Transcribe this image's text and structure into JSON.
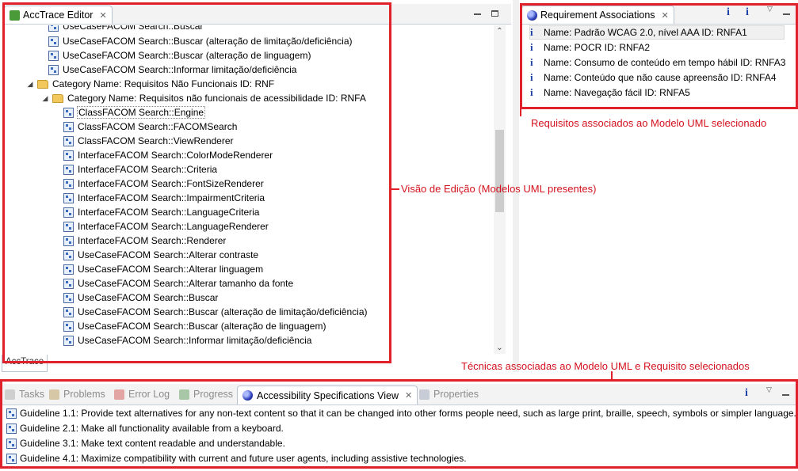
{
  "editor": {
    "title": "AccTrace Editor",
    "rows": [
      {
        "kind": "item",
        "indent": 3,
        "text": "UseCaseFACOM Search::Buscar",
        "partial": true
      },
      {
        "kind": "item",
        "indent": 3,
        "text": "UseCaseFACOM Search::Buscar (alteração de limitação/deficiência)"
      },
      {
        "kind": "item",
        "indent": 3,
        "text": "UseCaseFACOM Search::Buscar (alteração de linguagem)"
      },
      {
        "kind": "item",
        "indent": 3,
        "text": "UseCaseFACOM Search::Informar limitação/deficiência"
      },
      {
        "kind": "folder",
        "indent": 1,
        "text": "Category Name: Requisitos Não Funcionais ID: RNF"
      },
      {
        "kind": "folder",
        "indent": 2,
        "text": "Category Name: Requisitos não funcionais de acessibilidade ID: RNFA"
      },
      {
        "kind": "item",
        "indent": 4,
        "text": "ClassFACOM Search::Engine",
        "selected": true
      },
      {
        "kind": "item",
        "indent": 4,
        "text": "ClassFACOM Search::FACOMSearch"
      },
      {
        "kind": "item",
        "indent": 4,
        "text": "ClassFACOM Search::ViewRenderer"
      },
      {
        "kind": "item",
        "indent": 4,
        "text": "InterfaceFACOM Search::ColorModeRenderer"
      },
      {
        "kind": "item",
        "indent": 4,
        "text": "InterfaceFACOM Search::Criteria"
      },
      {
        "kind": "item",
        "indent": 4,
        "text": "InterfaceFACOM Search::FontSizeRenderer"
      },
      {
        "kind": "item",
        "indent": 4,
        "text": "InterfaceFACOM Search::ImpairmentCriteria"
      },
      {
        "kind": "item",
        "indent": 4,
        "text": "InterfaceFACOM Search::LanguageCriteria"
      },
      {
        "kind": "item",
        "indent": 4,
        "text": "InterfaceFACOM Search::LanguageRenderer"
      },
      {
        "kind": "item",
        "indent": 4,
        "text": "InterfaceFACOM Search::Renderer"
      },
      {
        "kind": "item",
        "indent": 4,
        "text": "UseCaseFACOM Search::Alterar contraste"
      },
      {
        "kind": "item",
        "indent": 4,
        "text": "UseCaseFACOM Search::Alterar linguagem"
      },
      {
        "kind": "item",
        "indent": 4,
        "text": "UseCaseFACOM Search::Alterar tamanho da fonte"
      },
      {
        "kind": "item",
        "indent": 4,
        "text": "UseCaseFACOM Search::Buscar"
      },
      {
        "kind": "item",
        "indent": 4,
        "text": "UseCaseFACOM Search::Buscar (alteração de limitação/deficiência)"
      },
      {
        "kind": "item",
        "indent": 4,
        "text": "UseCaseFACOM Search::Buscar (alteração de linguagem)"
      },
      {
        "kind": "item",
        "indent": 4,
        "text": "UseCaseFACOM Search::Informar limitação/deficiência"
      }
    ],
    "bottom_tab": "AccTrace"
  },
  "requirements": {
    "title": "Requirement Associations",
    "items": [
      "Name: Padrão WCAG 2.0, nível AAA ID: RNFA1",
      "Name: POCR ID: RNFA2",
      "Name: Consumo de conteúdo em tempo hábil ID: RNFA3",
      "Name: Conteúdo que não cause apreensão ID: RNFA4",
      "Name: Navegação fácil ID: RNFA5"
    ]
  },
  "bottom": {
    "tabs": [
      {
        "label": "Tasks",
        "active": false
      },
      {
        "label": "Problems",
        "active": false
      },
      {
        "label": "Error Log",
        "active": false
      },
      {
        "label": "Progress",
        "active": false
      },
      {
        "label": "Accessibility Specifications View",
        "active": true
      },
      {
        "label": "Properties",
        "active": false
      }
    ],
    "guidelines": [
      "Guideline 1.1: Provide text alternatives for any non-text content so that it can be changed into other forms people need, such as large print, braille, speech, symbols or simpler language.",
      "Guideline 2.1:  Make all functionality available from a keyboard.",
      "Guideline 3.1:  Make text content readable and understandable.",
      "Guideline 4.1: Maximize compatibility with current and future user agents, including assistive technologies."
    ]
  },
  "annotations": {
    "requirements": "Requisitos associados ao Modelo UML selecionado",
    "editor": "Visão de Edição (Modelos UML presentes)",
    "bottom": "Técnicas associadas ao Modelo UML e Requisito selecionados"
  },
  "colors": {
    "annotation": "#e0202a",
    "info": "#1a3fa8"
  }
}
